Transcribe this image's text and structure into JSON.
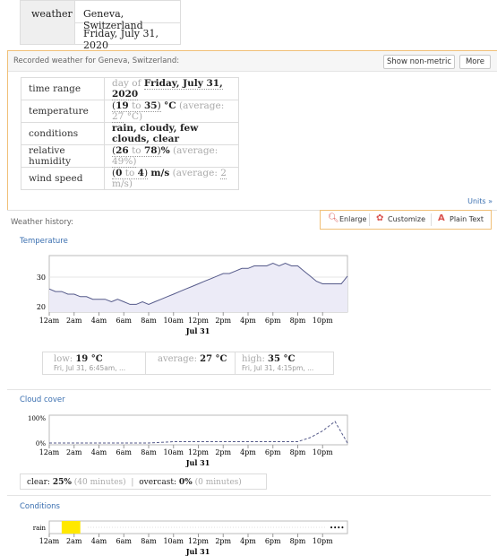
{
  "query": {
    "label": "weather",
    "location": "Geneva, Switzerland",
    "date": "Friday, July 31, 2020"
  },
  "recorded": {
    "title": "Recorded weather for Geneva, Switzerland:",
    "show_non_metric": "Show non-metric",
    "more": "More",
    "rows": {
      "time_range": {
        "label": "time range",
        "prefix": "day of",
        "value": "Friday, July 31, 2020"
      },
      "temperature": {
        "label": "temperature",
        "open": "(",
        "low": "19",
        "to": "to",
        "high": "35",
        "close": ")",
        "unit": "°C",
        "avg_text": "(average:",
        "avg": "27",
        "avg_unit": "°C)"
      },
      "conditions": {
        "label": "conditions",
        "value": "rain, cloudy, few clouds, clear"
      },
      "humidity": {
        "label": "relative humidity",
        "open": "(",
        "low": "26",
        "to": "to",
        "high": "78",
        "close": ")",
        "unit": "%",
        "avg_text": "(average:",
        "avg": "49%)"
      },
      "wind": {
        "label": "wind speed",
        "open": "(",
        "low": "0",
        "to": "to",
        "high": "4",
        "close": ")",
        "unit": "m/s",
        "avg_text": "(average:",
        "avg": "2",
        "avg_unit": "m/s)"
      }
    },
    "units_link": "Units »"
  },
  "history": {
    "title": "Weather history:",
    "tools": {
      "enlarge": "Enlarge",
      "customize": "Customize",
      "plain_text": "Plain Text"
    },
    "temperature_title": "Temperature",
    "cloud_title": "Cloud cover",
    "conditions_title": "Conditions",
    "x_ticks": [
      "12am",
      "2am",
      "4am",
      "6am",
      "8am",
      "10am",
      "12pm",
      "2pm",
      "4pm",
      "6pm",
      "8pm",
      "10pm"
    ],
    "x_date": "Jul 31",
    "stats": {
      "low_label": "low:",
      "low_value": "19 °C",
      "low_sub": "Fri, Jul 31, 6:45am, ...",
      "avg_label": "average:",
      "avg_value": "27 °C",
      "high_label": "high:",
      "high_value": "35 °C",
      "high_sub": "Fri, Jul 31, 4:15pm, ..."
    },
    "cloud_summary": {
      "clear_label": "clear:",
      "clear_value": "25%",
      "clear_minutes": "(40 minutes)",
      "sep": "|",
      "overcast_label": "overcast:",
      "overcast_value": "0%",
      "overcast_minutes": "(0 minutes)"
    },
    "cond_label": "rain",
    "cond_dots": "••••"
  },
  "chart_data": [
    {
      "type": "area",
      "title": "Temperature",
      "ylabel": "",
      "yticks": [
        "30",
        "20"
      ],
      "ylim": [
        16,
        38
      ],
      "x": [
        0,
        0.5,
        1,
        1.5,
        2,
        2.5,
        3,
        3.5,
        4,
        4.5,
        5,
        5.5,
        6,
        6.5,
        7,
        7.5,
        8,
        8.5,
        9,
        9.5,
        10,
        10.5,
        11,
        11.5,
        12,
        12.5,
        13,
        13.5,
        14,
        14.5,
        15,
        15.5,
        16,
        16.5,
        17,
        17.5,
        18,
        18.5,
        19,
        19.5,
        20,
        20.5,
        21,
        21.5,
        22,
        22.5,
        23,
        23.5,
        24
      ],
      "series": [
        {
          "values": [
            25,
            24,
            24,
            23,
            23,
            22,
            22,
            21,
            21,
            21,
            20,
            21,
            20,
            19,
            19,
            20,
            19,
            20,
            21,
            22,
            23,
            24,
            25,
            26,
            27,
            28,
            29,
            30,
            31,
            31,
            32,
            33,
            33,
            34,
            34,
            34,
            35,
            34,
            35,
            34,
            34,
            32,
            30,
            28,
            27,
            27,
            27,
            27,
            30
          ]
        }
      ]
    },
    {
      "type": "line",
      "title": "Cloud cover",
      "yticks": [
        "100%",
        "0%"
      ],
      "ylim": [
        0,
        100
      ],
      "x": [
        0,
        2,
        4,
        6,
        8,
        10,
        12,
        14,
        16,
        18,
        19,
        20,
        21,
        22,
        23,
        24
      ],
      "series": [
        {
          "values": [
            0,
            0,
            0,
            0,
            0,
            5,
            5,
            5,
            5,
            5,
            5,
            5,
            20,
            45,
            80,
            0
          ]
        }
      ]
    },
    {
      "type": "bar",
      "title": "Conditions",
      "categories": [
        "rain"
      ],
      "segments": [
        {
          "start": 1,
          "end": 2.5,
          "color": "#ffe800"
        }
      ]
    }
  ]
}
